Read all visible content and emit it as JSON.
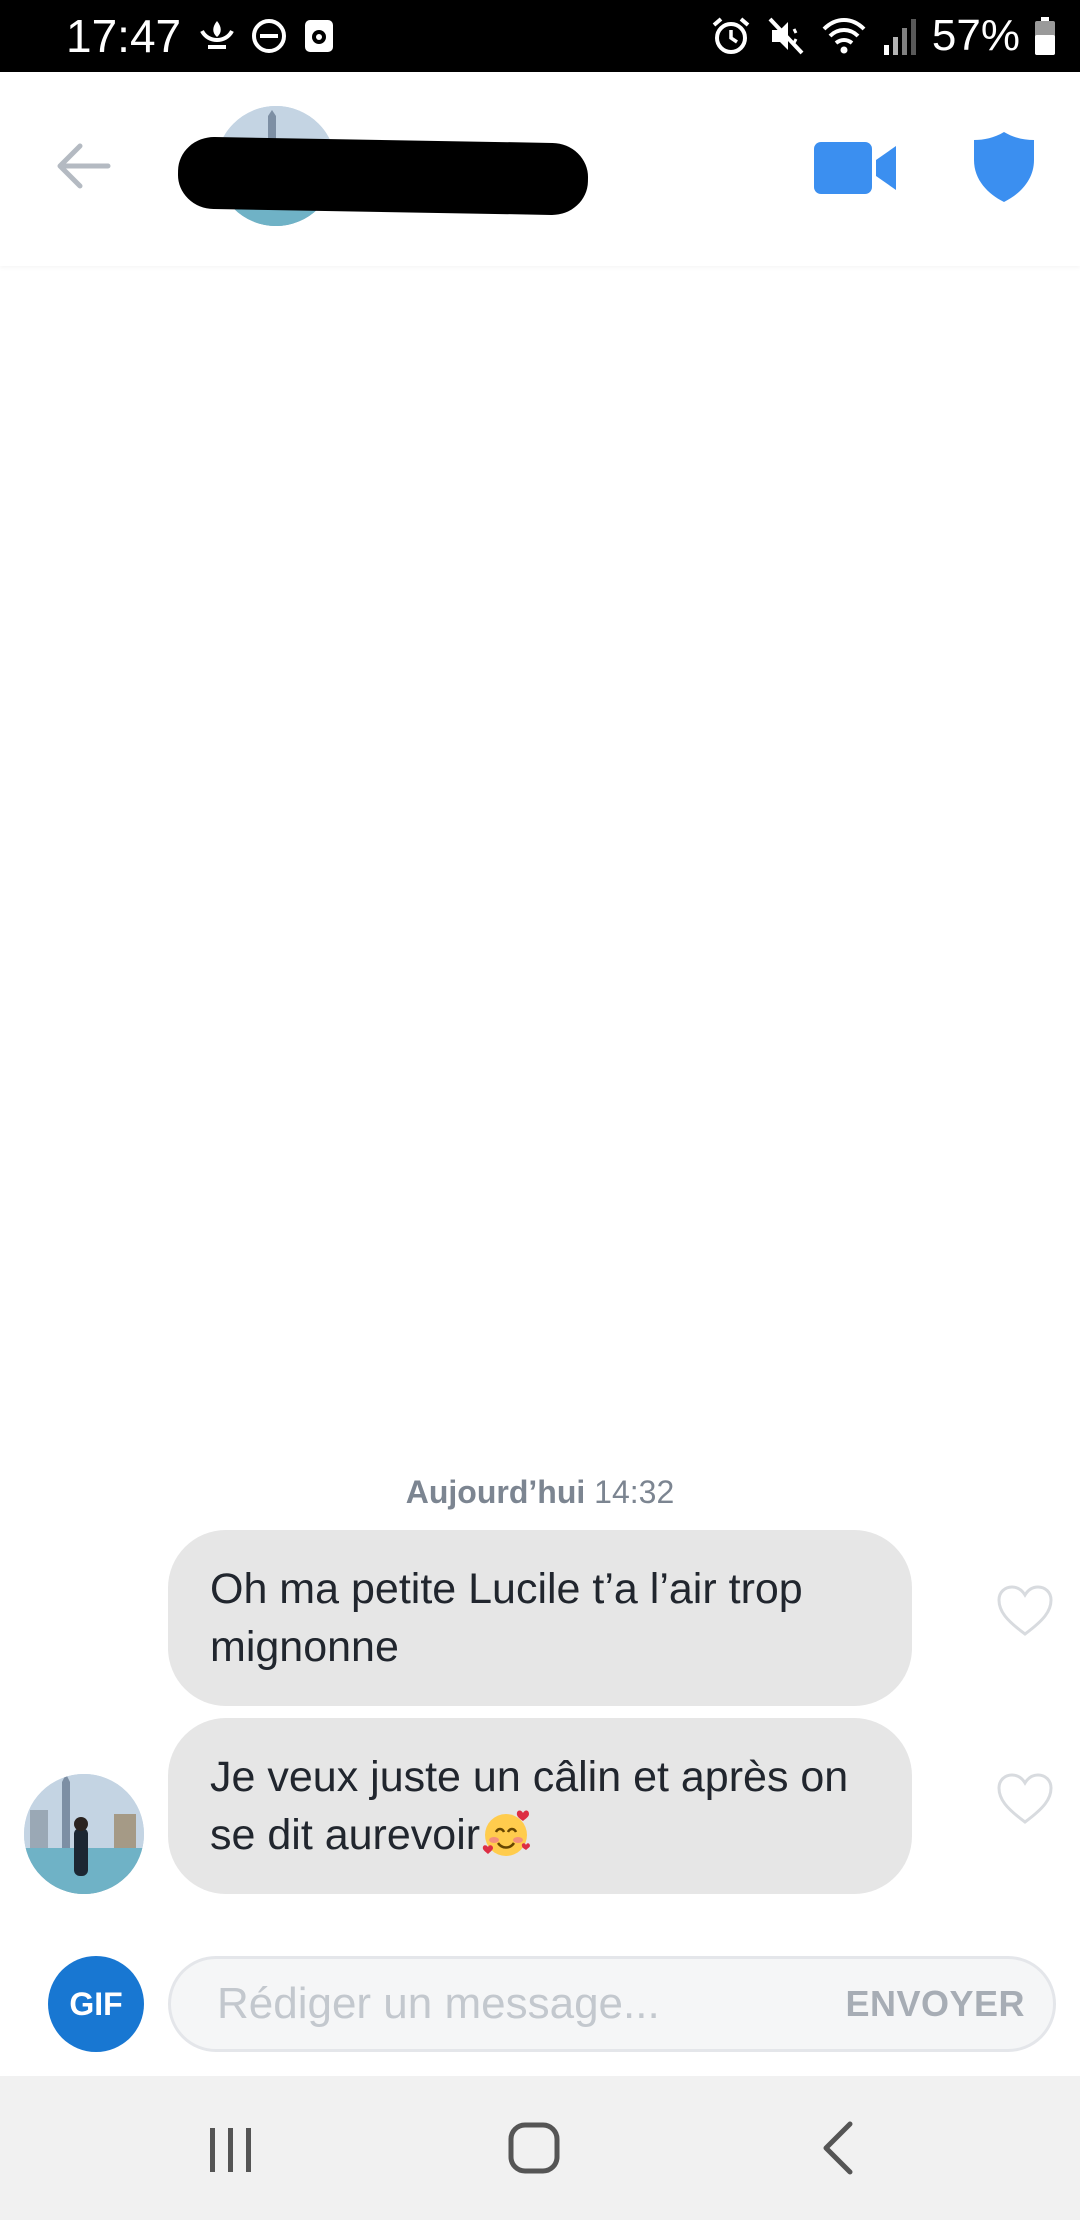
{
  "status_bar": {
    "time": "17:47",
    "battery": "57%",
    "left_icons": [
      "notification-icon",
      "do-not-disturb-icon",
      "screenshot-icon"
    ],
    "right_icons": [
      "alarm-icon",
      "mute-icon",
      "wifi-icon",
      "signal-icon",
      "battery-icon"
    ]
  },
  "header": {
    "contact_name": "",
    "back_icon": "arrow-left-icon",
    "video_icon": "video-camera-icon",
    "safety_icon": "shield-icon"
  },
  "conversation": {
    "timestamp_day": "Aujourd’hui",
    "timestamp_time": "14:32",
    "messages": [
      {
        "text": "Oh ma petite Lucile t’a l’air trop mignonne",
        "liked": false
      },
      {
        "text": "Je veux juste un câlin et après on se dit aurevoir",
        "emoji": "smiling-face-with-hearts",
        "liked": false
      }
    ]
  },
  "composer": {
    "gif_label": "GIF",
    "placeholder": "Rédiger un message...",
    "send_label": "ENVOYER"
  },
  "colors": {
    "accent": "#1877d2",
    "header_icons": "#3b8ff0",
    "bubble": "#e6e6e6",
    "status_bar": "#000000",
    "nav_bar": "#f1f1f1"
  },
  "nav_bar": {
    "icons": [
      "recents-icon",
      "home-icon",
      "back-icon"
    ]
  }
}
